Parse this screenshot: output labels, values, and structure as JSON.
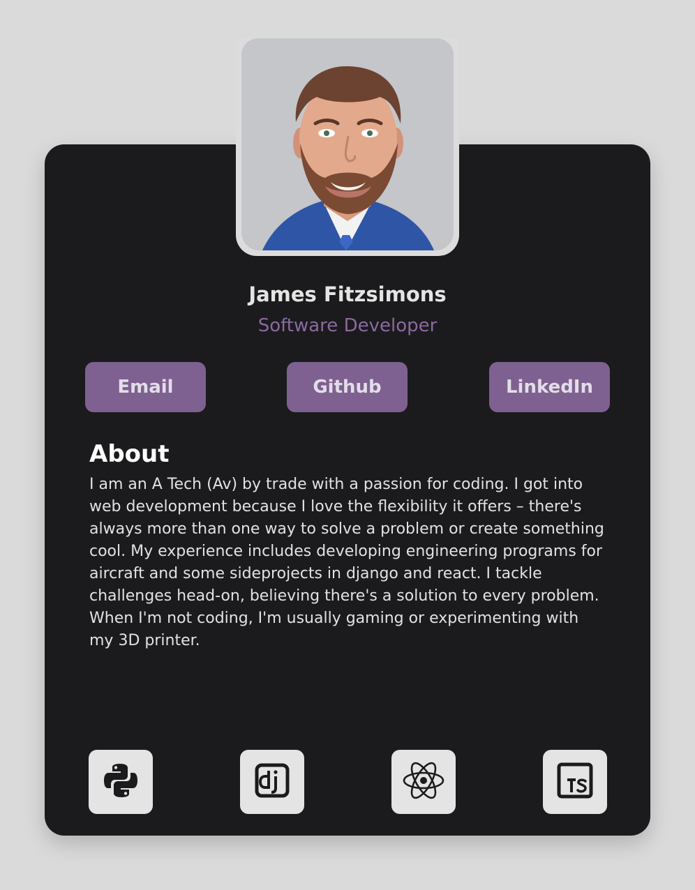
{
  "profile": {
    "name": "James Fitzsimons",
    "role": "Software Developer",
    "photo_icon": "profile-photo"
  },
  "links": {
    "email_label": "Email",
    "github_label": "Github",
    "linkedin_label": "LinkedIn"
  },
  "about": {
    "title": "About",
    "body": "I am an A Tech (Av) by trade with a passion for coding. I got into web development because I love the flexibility it offers – there's always more than one way to solve a problem or create something cool. My experience includes developing engineering programs for aircraft and some sideprojects in django and react. I tackle challenges head-on, believing there's a solution to every problem. When I'm not coding, I'm usually gaming or experimenting with my 3D printer."
  },
  "tech_stack": [
    {
      "icon": "python-icon"
    },
    {
      "icon": "django-icon"
    },
    {
      "icon": "react-icon"
    },
    {
      "icon": "typescript-icon"
    }
  ],
  "colors": {
    "page_background": "#dadada",
    "card_background": "#1b1b1d",
    "accent": "#7e6190",
    "role_text": "#8a6aa0",
    "tile_background": "#e4e4e4"
  }
}
